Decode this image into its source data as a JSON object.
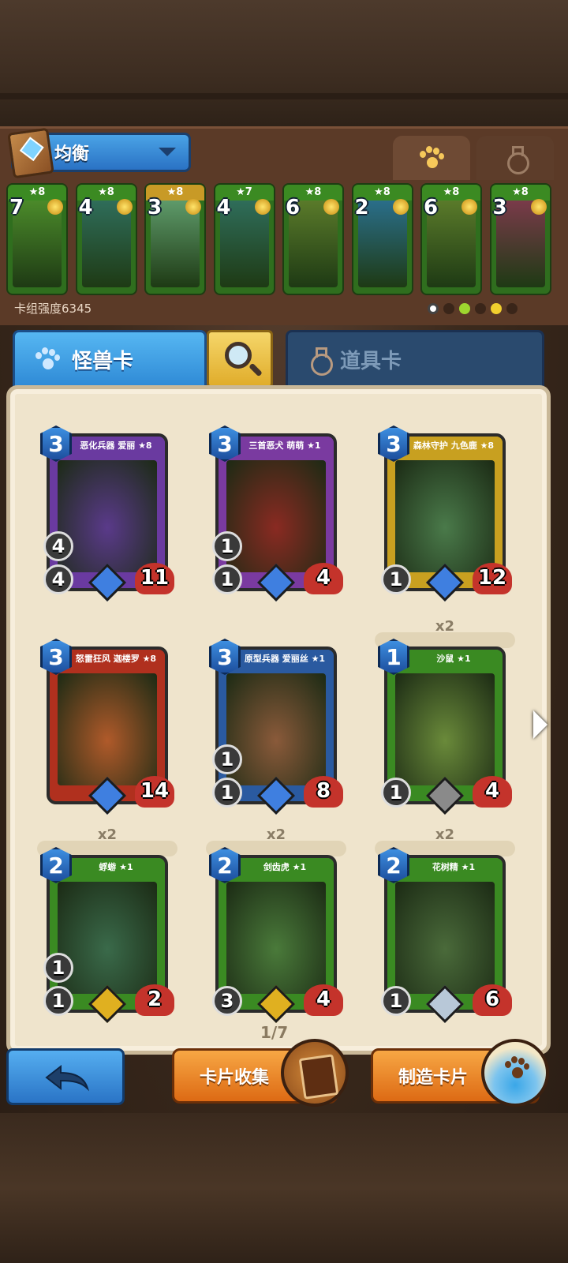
{
  "deck": {
    "name": "均衡",
    "power_label": "卡组强度6345",
    "cards": [
      {
        "cost": "7",
        "stars": "★8",
        "color": "#4b8a2a"
      },
      {
        "cost": "4",
        "stars": "★8",
        "color": "#2f6d5a"
      },
      {
        "cost": "3",
        "stars": "★8",
        "color": "#5e9a6a"
      },
      {
        "cost": "4",
        "stars": "★7",
        "color": "#2f6d5a"
      },
      {
        "cost": "6",
        "stars": "★8",
        "color": "#5a7a2a"
      },
      {
        "cost": "2",
        "stars": "★8",
        "color": "#2a6e8a"
      },
      {
        "cost": "6",
        "stars": "★8",
        "color": "#5a7a2a"
      },
      {
        "cost": "3",
        "stars": "★8",
        "color": "#7a3a4a"
      }
    ]
  },
  "tabs": {
    "monster": "怪兽卡",
    "items": "道具卡"
  },
  "page": "1/7",
  "cards": [
    {
      "title": "恶化兵器 爱丽 ★8",
      "cost": "3",
      "mid": "4",
      "atk": "4",
      "hp": "11",
      "copies": "",
      "art": "#5a3a8a",
      "frame": "#6a3aa0",
      "rarity": "#3f7fe0"
    },
    {
      "title": "三首恶犬 萌萌 ★1",
      "cost": "3",
      "mid": "1",
      "atk": "1",
      "hp": "4",
      "copies": "",
      "art": "#8a2a22",
      "frame": "#7a3aa0",
      "rarity": "#3f7fe0"
    },
    {
      "title": "森林守护 九色鹿 ★8",
      "cost": "3",
      "mid": "",
      "atk": "1",
      "hp": "12",
      "copies": "",
      "art": "#4a7a4a",
      "frame": "#c8a020",
      "rarity": "#3f7fe0"
    },
    {
      "title": "怒雷狂风 迦楼罗 ★8",
      "cost": "3",
      "mid": "",
      "atk": "",
      "hp": "14",
      "copies": "",
      "art": "#b05a2a",
      "frame": "#b0301e",
      "rarity": "#3f7fe0"
    },
    {
      "title": "原型兵器 爱丽丝 ★1",
      "cost": "3",
      "mid": "1",
      "atk": "1",
      "hp": "8",
      "copies": "",
      "art": "#8a5a3a",
      "frame": "#2a5aa0",
      "rarity": "#3f7fe0"
    },
    {
      "title": "沙鼠 ★1",
      "cost": "1",
      "mid": "",
      "atk": "1",
      "hp": "4",
      "copies": "x2",
      "art": "#6a8a3a",
      "frame": "#3a8a22",
      "rarity": "#8a8a8a"
    },
    {
      "title": "蜉蝣 ★1",
      "cost": "2",
      "mid": "1",
      "atk": "1",
      "hp": "2",
      "copies": "x2",
      "art": "#3a6a4a",
      "frame": "#3a8a22",
      "rarity": "#e0b020"
    },
    {
      "title": "剑齿虎 ★1",
      "cost": "2",
      "mid": "",
      "atk": "3",
      "hp": "4",
      "copies": "x2",
      "art": "#4a7a3a",
      "frame": "#3a8a22",
      "rarity": "#e0b020"
    },
    {
      "title": "花树精 ★1",
      "cost": "2",
      "mid": "",
      "atk": "1",
      "hp": "6",
      "copies": "x2",
      "art": "#4a6a3a",
      "frame": "#3a8a22",
      "rarity": "#b8c8d8"
    }
  ],
  "buttons": {
    "collect": "卡片收集",
    "craft": "制造卡片"
  }
}
